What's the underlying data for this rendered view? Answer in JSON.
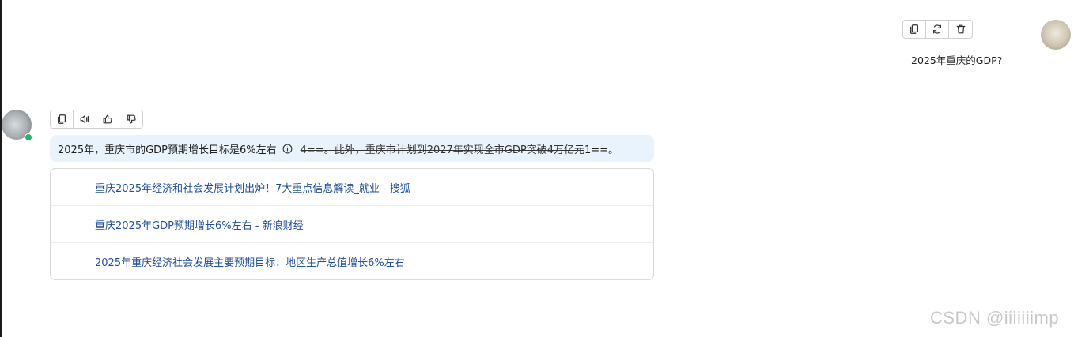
{
  "user_message": {
    "text": "2025年重庆的GDP?",
    "actions": [
      {
        "icon": "copy-icon"
      },
      {
        "icon": "refresh-icon"
      },
      {
        "icon": "trash-icon"
      }
    ]
  },
  "bot_message": {
    "actions": [
      {
        "icon": "copy-icon"
      },
      {
        "icon": "speaker-icon"
      },
      {
        "icon": "thumbs-up-icon"
      },
      {
        "icon": "thumbs-down-icon"
      }
    ],
    "answer_main": "2025年，重庆市的GDP预期增长目标是6%左右",
    "answer_struck": "4==。此外，重庆市计划到2027年实现全市GDP突破4万亿元",
    "answer_tail": "1==。",
    "sources": [
      {
        "title": "重庆2025年经济和社会发展计划出炉！7大重点信息解读_就业 - 搜狐"
      },
      {
        "title": "重庆2025年GDP预期增长6%左右 - 新浪财经"
      },
      {
        "title": "2025年重庆经济社会发展主要预期目标：地区生产总值增长6%左右"
      }
    ],
    "status_color": "#1fb86a"
  },
  "watermark": "CSDN @iiiiiiimp"
}
